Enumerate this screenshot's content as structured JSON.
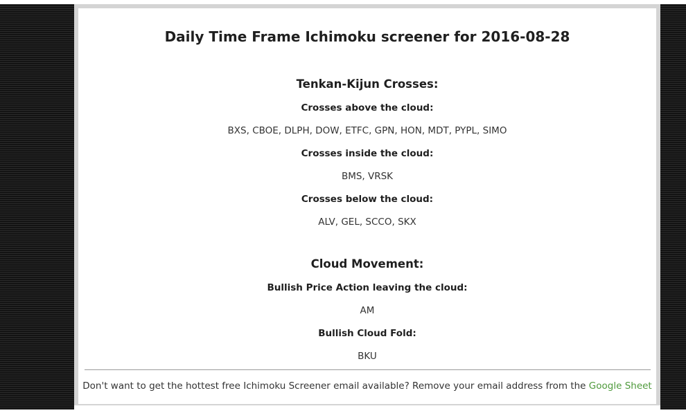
{
  "title": "Daily Time Frame Ichimoku screener for 2016-08-28",
  "sections": [
    {
      "heading": "Tenkan-Kijun Crosses:",
      "groups": [
        {
          "label": "Crosses above the cloud:",
          "value": "BXS, CBOE, DLPH, DOW, ETFC, GPN, HON, MDT, PYPL, SIMO"
        },
        {
          "label": "Crosses inside the cloud:",
          "value": "BMS, VRSK"
        },
        {
          "label": "Crosses below the cloud:",
          "value": "ALV, GEL, SCCO, SKX"
        }
      ]
    },
    {
      "heading": "Cloud Movement:",
      "groups": [
        {
          "label": "Bullish Price Action leaving the cloud:",
          "value": "AM"
        },
        {
          "label": "Bullish Cloud Fold:",
          "value": "BKU"
        }
      ]
    }
  ],
  "footer": {
    "text": "Don't want to get the hottest free Ichimoku Screener email available? Remove your email address from the",
    "link_label": "Google Sheet",
    "link_color": "#4f9a3c"
  }
}
